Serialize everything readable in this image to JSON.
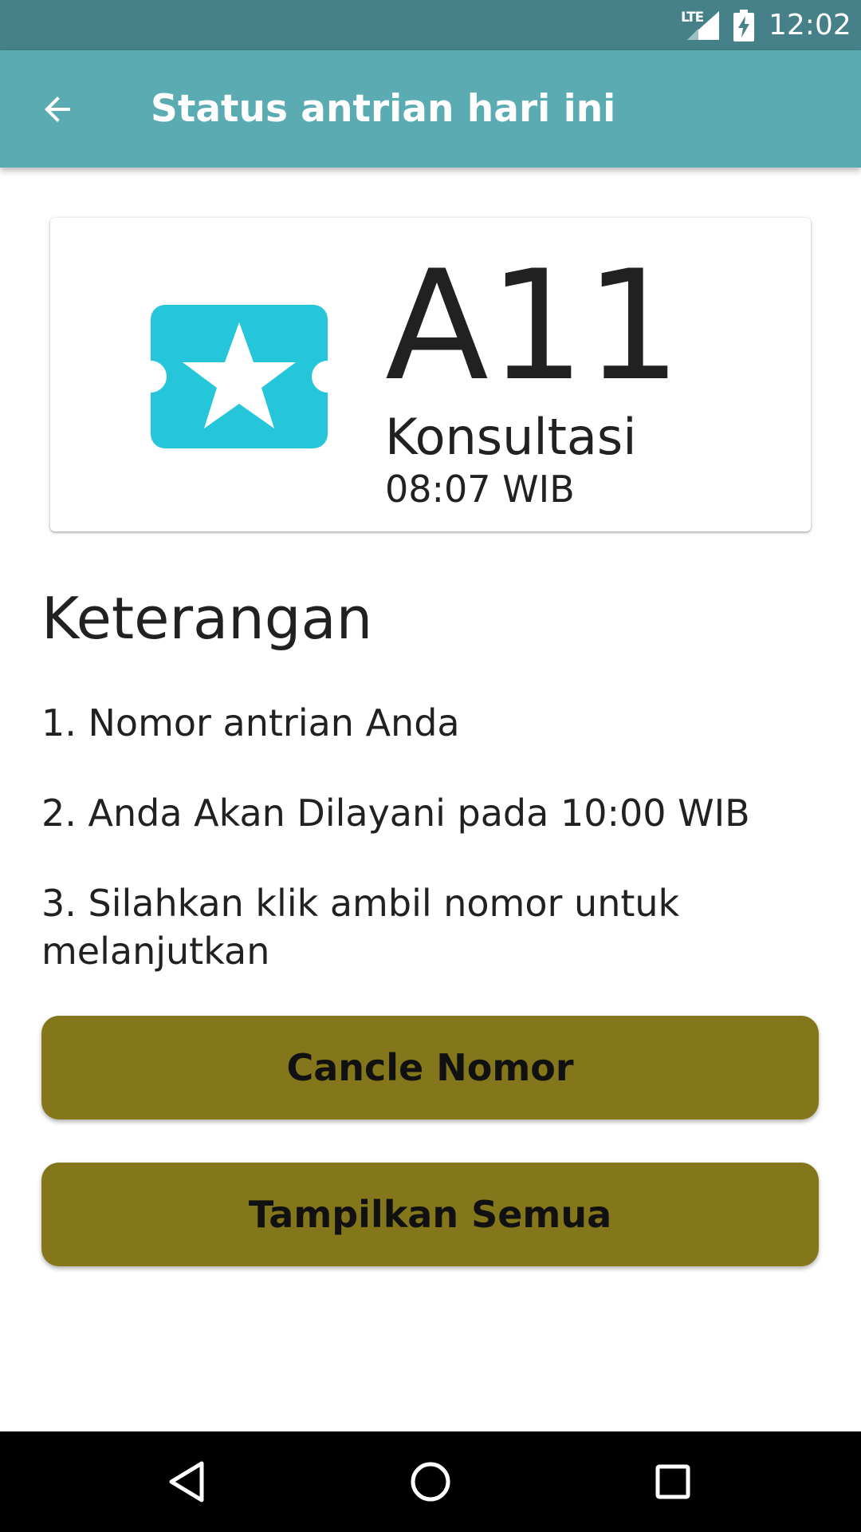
{
  "status_bar": {
    "network": "LTE",
    "time": "12:02"
  },
  "app_bar": {
    "title": "Status antrian hari ini",
    "back_icon": "arrow-back-icon"
  },
  "ticket": {
    "icon": "ticket-star-icon",
    "icon_color": "#26C6DA",
    "number": "A11",
    "service": "Konsultasi",
    "time": "08:07 WIB"
  },
  "info": {
    "heading": "Keterangan",
    "lines": [
      "1. Nomor antrian Anda",
      "2. Anda Akan Dilayani pada 10:00 WIB",
      "3. Silahkan klik ambil nomor untuk melanjutkan"
    ]
  },
  "buttons": {
    "cancel_label": "Cancle Nomor",
    "show_all_label": "Tampilkan Semua",
    "color": "#84771B"
  },
  "colors": {
    "status_bar": "#468088",
    "app_bar": "#5AACB2"
  },
  "nav_bar": {
    "back_icon": "nav-back-icon",
    "home_icon": "nav-home-icon",
    "recents_icon": "nav-recents-icon"
  }
}
